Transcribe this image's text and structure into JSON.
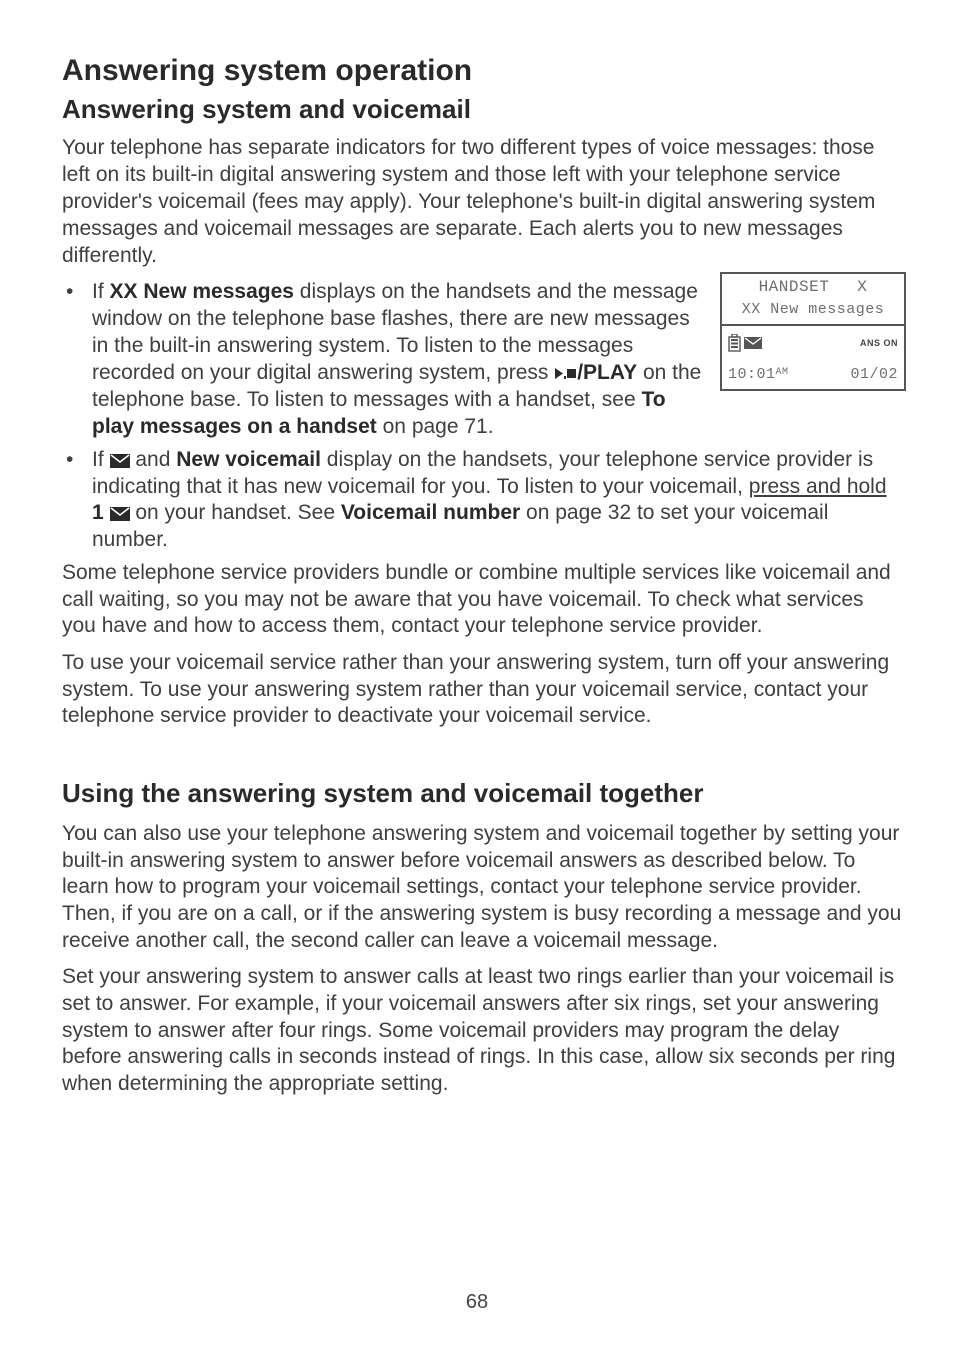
{
  "title": "Answering system operation",
  "subtitle": "Answering system and voicemail",
  "intro": "Your telephone has separate indicators for two different types of voice messages: those left on its built-in digital answering system and those left with your telephone service provider's voicemail (fees may apply). Your telephone's built-in digital answering system messages and voicemail messages are separate. Each alerts you to new messages differently.",
  "bullets": {
    "b1": {
      "pre": "If ",
      "bold1": "XX New messages",
      "mid1": " displays on the handsets and the message window on the telephone base flashes, there are new messages in the built-in answering system. To listen to the messages recorded on your digital answering system, press ",
      "bold2": "/PLAY",
      "mid2": " on the telephone base. To listen to messages with a handset, see ",
      "bold3": "To play messages on a handset",
      "post": " on page 71."
    },
    "b2": {
      "pre": "If ",
      "mid1": " and ",
      "bold1": "New voicemail",
      "mid2": " display on the handsets, your telephone service provider is indicating that it has new voicemail for you. To listen to your voicemail, ",
      "und": "press and hold",
      "mid3": " ",
      "bold2": "1",
      "mid4": " ",
      "mid5": " on your handset. See ",
      "bold3": "Voicemail number",
      "post": " on page 32 to set your voicemail number."
    }
  },
  "para2": "Some telephone service providers bundle or combine multiple services like voicemail and call waiting, so you may not be aware that you have voicemail. To check what services you have and how to access them, contact your telephone service provider.",
  "para3": "To use your voicemail service rather than your answering system, turn off your answering system. To use your answering system rather than your voicemail service, contact your telephone service provider to deactivate your voicemail service.",
  "h3": "Using the answering system and voicemail together",
  "para4": "You can also use your telephone answering system and voicemail together by setting your built-in answering system to answer before voicemail answers as described below. To learn how to program your voicemail settings, contact your telephone service provider. Then, if you are on a call, or if the answering system is busy recording a message and you receive another call, the second caller can leave a voicemail message.",
  "para5": "Set your answering system to answer calls at least two rings earlier than your voicemail is set to answer. For example, if your voicemail answers after six rings, set your answering system to answer after four rings. Some voicemail providers may program the delay before answering calls in seconds instead of rings. In this case, allow six seconds per ring when determining the appropriate setting.",
  "lcd": {
    "row1_label": "HANDSET",
    "row1_x": "X",
    "row2": "XX New messages",
    "row3_ans": "ANS ON",
    "row4_time": "10:01",
    "row4_ampm": "AM",
    "row4_date": "01/02"
  },
  "page": "68"
}
